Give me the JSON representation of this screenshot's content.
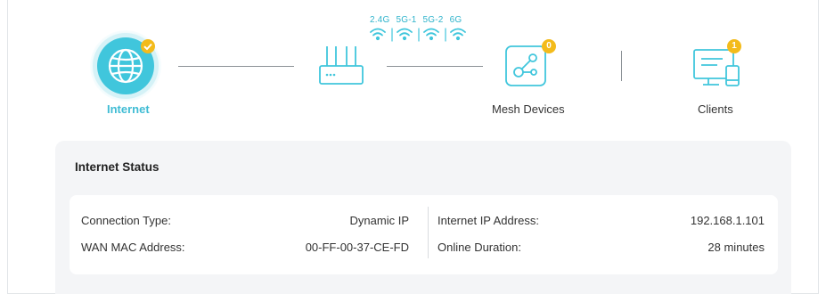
{
  "topology": {
    "internet": {
      "label": "Internet",
      "icon": "globe-icon",
      "badge_icon": "checkmark-icon",
      "status": "connected"
    },
    "router": {
      "icon": "router-icon",
      "bands": [
        "2.4G",
        "5G-1",
        "5G-2",
        "6G"
      ]
    },
    "mesh_devices": {
      "label": "Mesh Devices",
      "icon": "mesh-icon",
      "count": "0"
    },
    "clients": {
      "label": "Clients",
      "icon": "clients-icon",
      "count": "1"
    }
  },
  "internet_status": {
    "title": "Internet Status",
    "left": [
      {
        "label": "Connection Type:",
        "value": "Dynamic IP"
      },
      {
        "label": "WAN MAC Address:",
        "value": "00-FF-00-37-CE-FD"
      }
    ],
    "right": [
      {
        "label": "Internet IP Address:",
        "value": "192.168.1.101"
      },
      {
        "label": "Online Duration:",
        "value": "28 minutes"
      }
    ]
  },
  "colors": {
    "accent": "#40c6dc",
    "badge": "#f3bb1b",
    "panel_bg": "#f4f5f7",
    "line": "#8b9196"
  }
}
